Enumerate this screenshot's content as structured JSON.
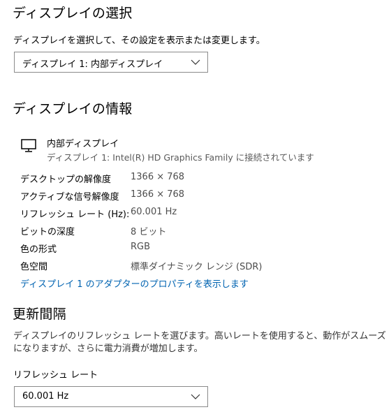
{
  "display_select": {
    "heading": "ディスプレイの選択",
    "description": "ディスプレイを選択して、その設定を表示または変更します。",
    "selected": "ディスプレイ 1: 内部ディスプレイ"
  },
  "display_info": {
    "heading": "ディスプレイの情報",
    "monitor_name": "内部ディスプレイ",
    "monitor_sub": "ディスプレイ 1: Intel(R) HD Graphics Family に接続されています",
    "rows": [
      {
        "label": "デスクトップの解像度",
        "value": "1366 × 768"
      },
      {
        "label": "アクティブな信号解像度",
        "value": "1366 × 768"
      },
      {
        "label": "リフレッシュ レート (Hz):",
        "value": "60.001 Hz"
      },
      {
        "label": "ビットの深度",
        "value": "8 ビット"
      },
      {
        "label": "色の形式",
        "value": "RGB"
      },
      {
        "label": "色空間",
        "value": "標準ダイナミック レンジ (SDR)"
      }
    ],
    "adapter_link": "ディスプレイ 1 のアダプターのプロパティを表示します"
  },
  "refresh": {
    "heading": "更新間隔",
    "description_line1": "ディスプレイのリフレッシュ レートを選びます。高いレートを使用すると、動作がスムーズ",
    "description_line2": "になりますが、さらに電力消費が増加します。",
    "rate_label": "リフレッシュ レート",
    "rate_selected": "60.001 Hz"
  },
  "icons": {
    "monitor": "monitor-icon",
    "chevron": "chevron-down-icon"
  },
  "colors": {
    "link": "#0063b1",
    "border": "#8a8a8a",
    "muted_text": "#5a5a5a"
  }
}
